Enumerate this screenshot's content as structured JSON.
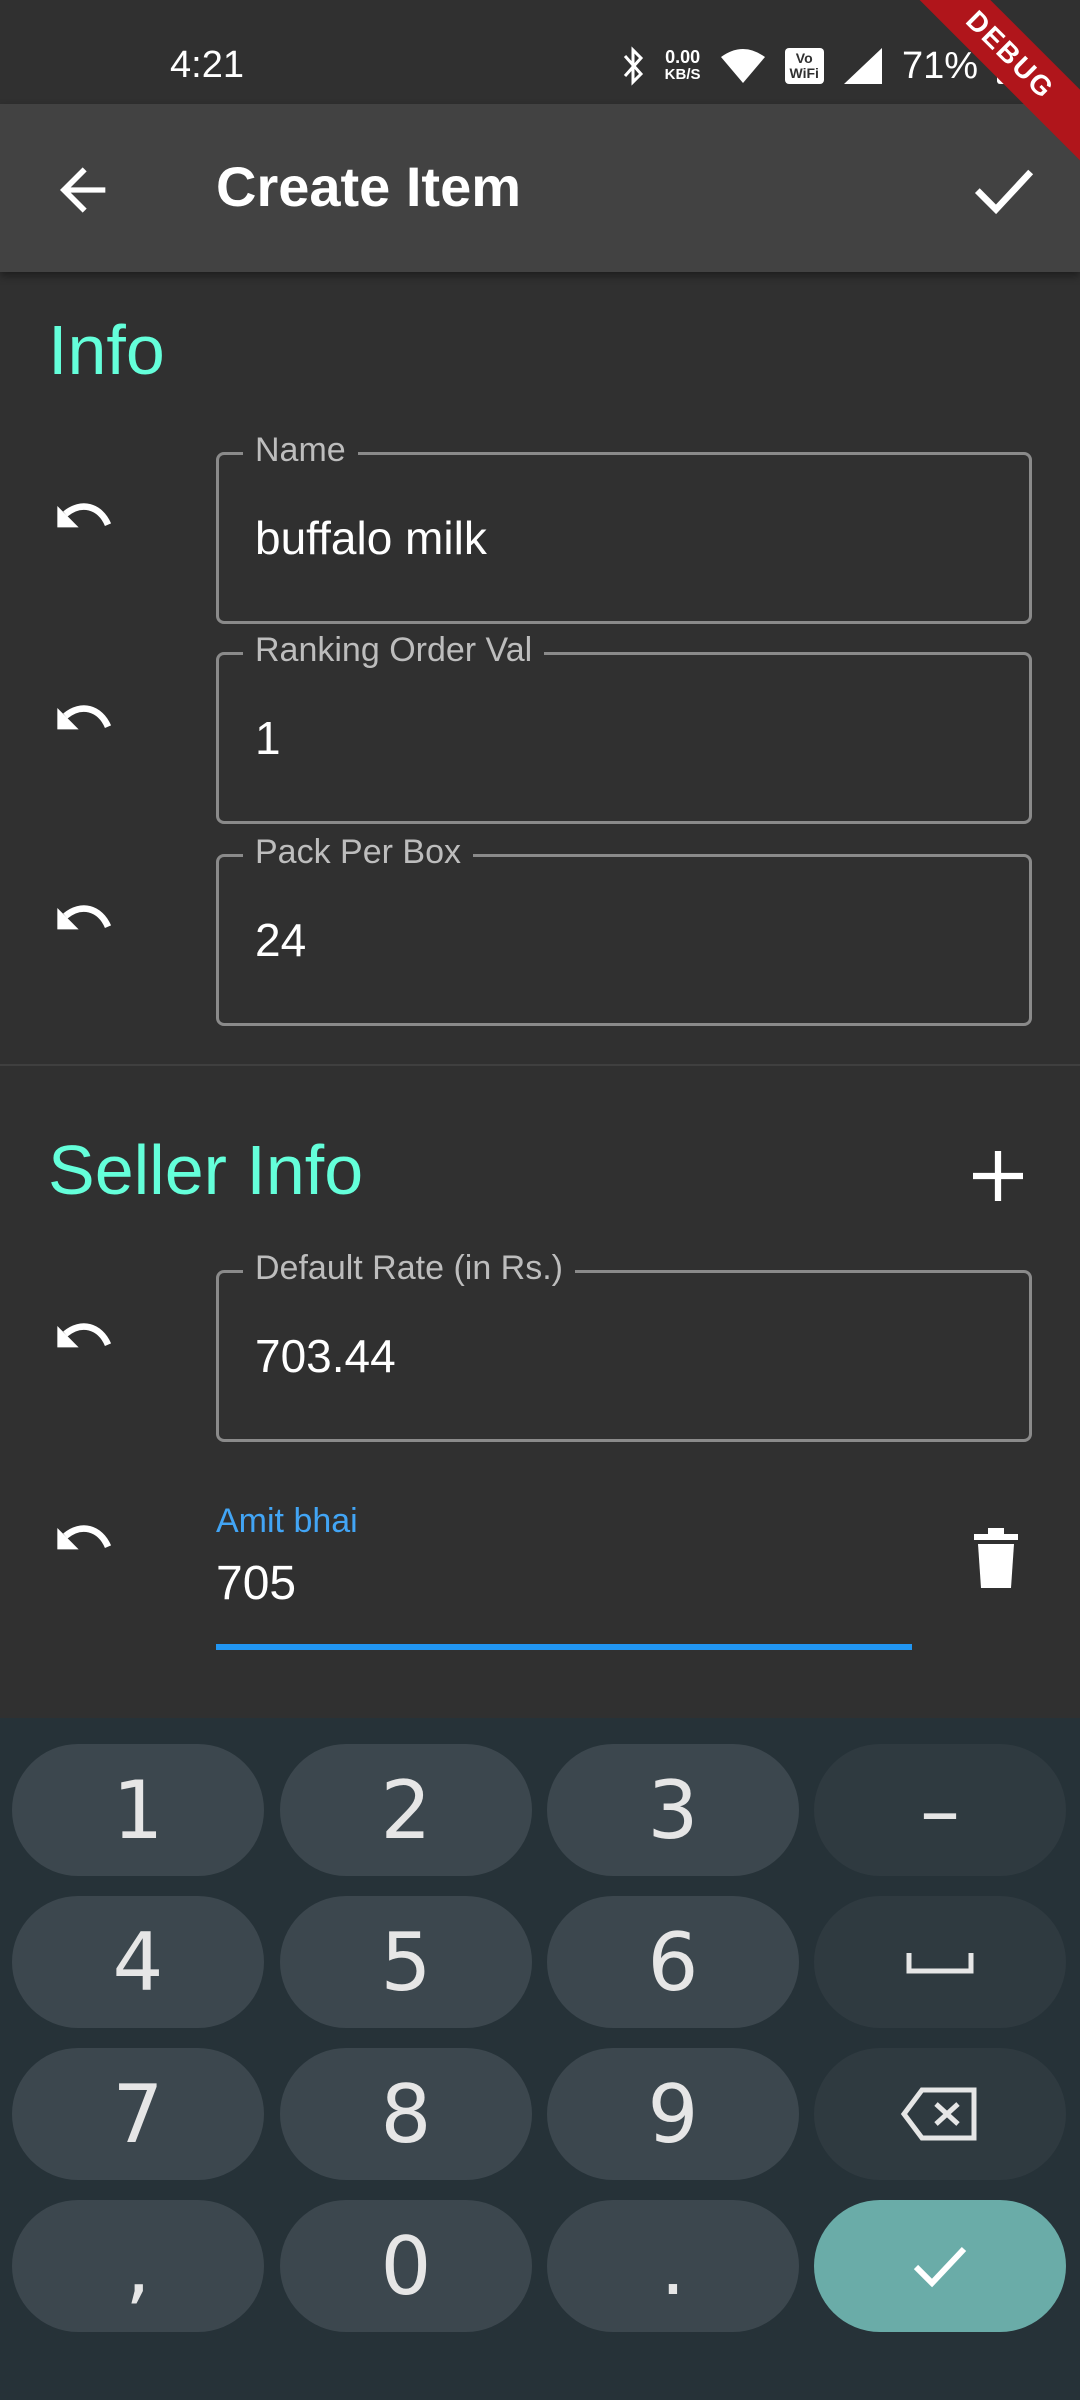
{
  "status_bar": {
    "time": "4:21",
    "net_speed_value": "0.00",
    "net_speed_unit": "KB/S",
    "wifi_label_top": "Vo",
    "wifi_label_bottom": "WiFi",
    "battery": "71%"
  },
  "debug_banner": "DEBUG",
  "app_bar": {
    "title": "Create Item",
    "back_icon": "arrow-back-icon",
    "confirm_icon": "check-icon"
  },
  "info_section": {
    "title": "Info",
    "fields": [
      {
        "label": "Name",
        "value": "buffalo milk"
      },
      {
        "label": "Ranking Order Val",
        "value": "1"
      },
      {
        "label": "Pack Per Box",
        "value": "24"
      }
    ]
  },
  "seller_section": {
    "title": "Seller Info",
    "add_icon": "plus-icon",
    "default_rate": {
      "label": "Default Rate (in Rs.)",
      "value": "703.44"
    },
    "seller_entry": {
      "label": "Amit bhai",
      "value": "705"
    }
  },
  "keyboard": {
    "keys": [
      "1",
      "2",
      "3",
      "–",
      "4",
      "5",
      "6",
      "␣",
      "7",
      "8",
      "9",
      "⌫",
      ",",
      "0",
      ".",
      "✓"
    ]
  },
  "colors": {
    "accent": "#64ffda",
    "focus": "#2196f3",
    "background": "#303030",
    "app_bar": "#424242",
    "keyboard": "#263238",
    "enter_key": "#6aaca8"
  }
}
